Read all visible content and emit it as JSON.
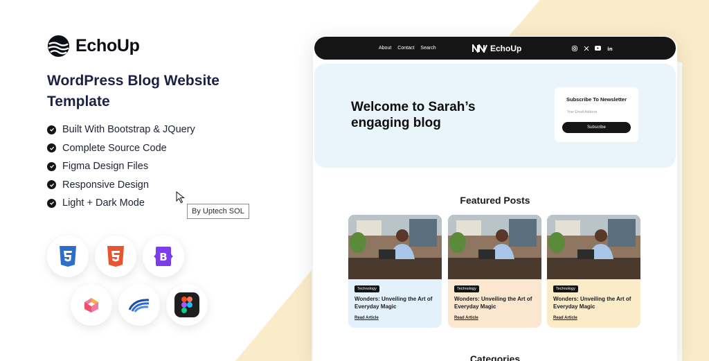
{
  "brand": {
    "name": "EchoUp"
  },
  "headline": "WordPress Blog Website Template",
  "features": [
    "Built With Bootstrap & JQuery",
    "Complete Source Code",
    "Figma Design Files",
    "Responsive Design",
    "Light + Dark Mode"
  ],
  "badge": "By Uptech SOL",
  "tech_icons": [
    "css3-icon",
    "html5-icon",
    "bootstrap-icon",
    "ui-kit-icon",
    "wordpress-icon",
    "figma-icon"
  ],
  "preview": {
    "nav": {
      "links": [
        "About",
        "Contact",
        "Search"
      ],
      "brand": "EchoUp",
      "socials": [
        "instagram-icon",
        "x-icon",
        "youtube-icon",
        "linkedin-icon"
      ]
    },
    "hero": {
      "title": "Welcome to Sarah’s engaging blog",
      "newsletter": {
        "title": "Subscribe To Newsletter",
        "placeholder": "Your Email Address",
        "button": "Subscribe"
      }
    },
    "featured": {
      "title": "Featured Posts",
      "cards": [
        {
          "tag": "Technology",
          "title": "Wonders: Unveiling the Art of Everyday Magic",
          "link": "Read Article"
        },
        {
          "tag": "Technology",
          "title": "Wonders: Unveiling the Art of Everyday Magic",
          "link": "Read Article"
        },
        {
          "tag": "Technology",
          "title": "Wonders: Unveiling the Art of Everyday Magic",
          "link": "Read Article"
        }
      ]
    },
    "categories_title": "Categories"
  },
  "colors": {
    "accent_cream": "#fbecc9",
    "hero_bg": "#eaf4fb",
    "card_blue": "#e3f1fb",
    "card_peach": "#fbe6cf",
    "card_yellow": "#fbebc9",
    "dark": "#151515"
  }
}
